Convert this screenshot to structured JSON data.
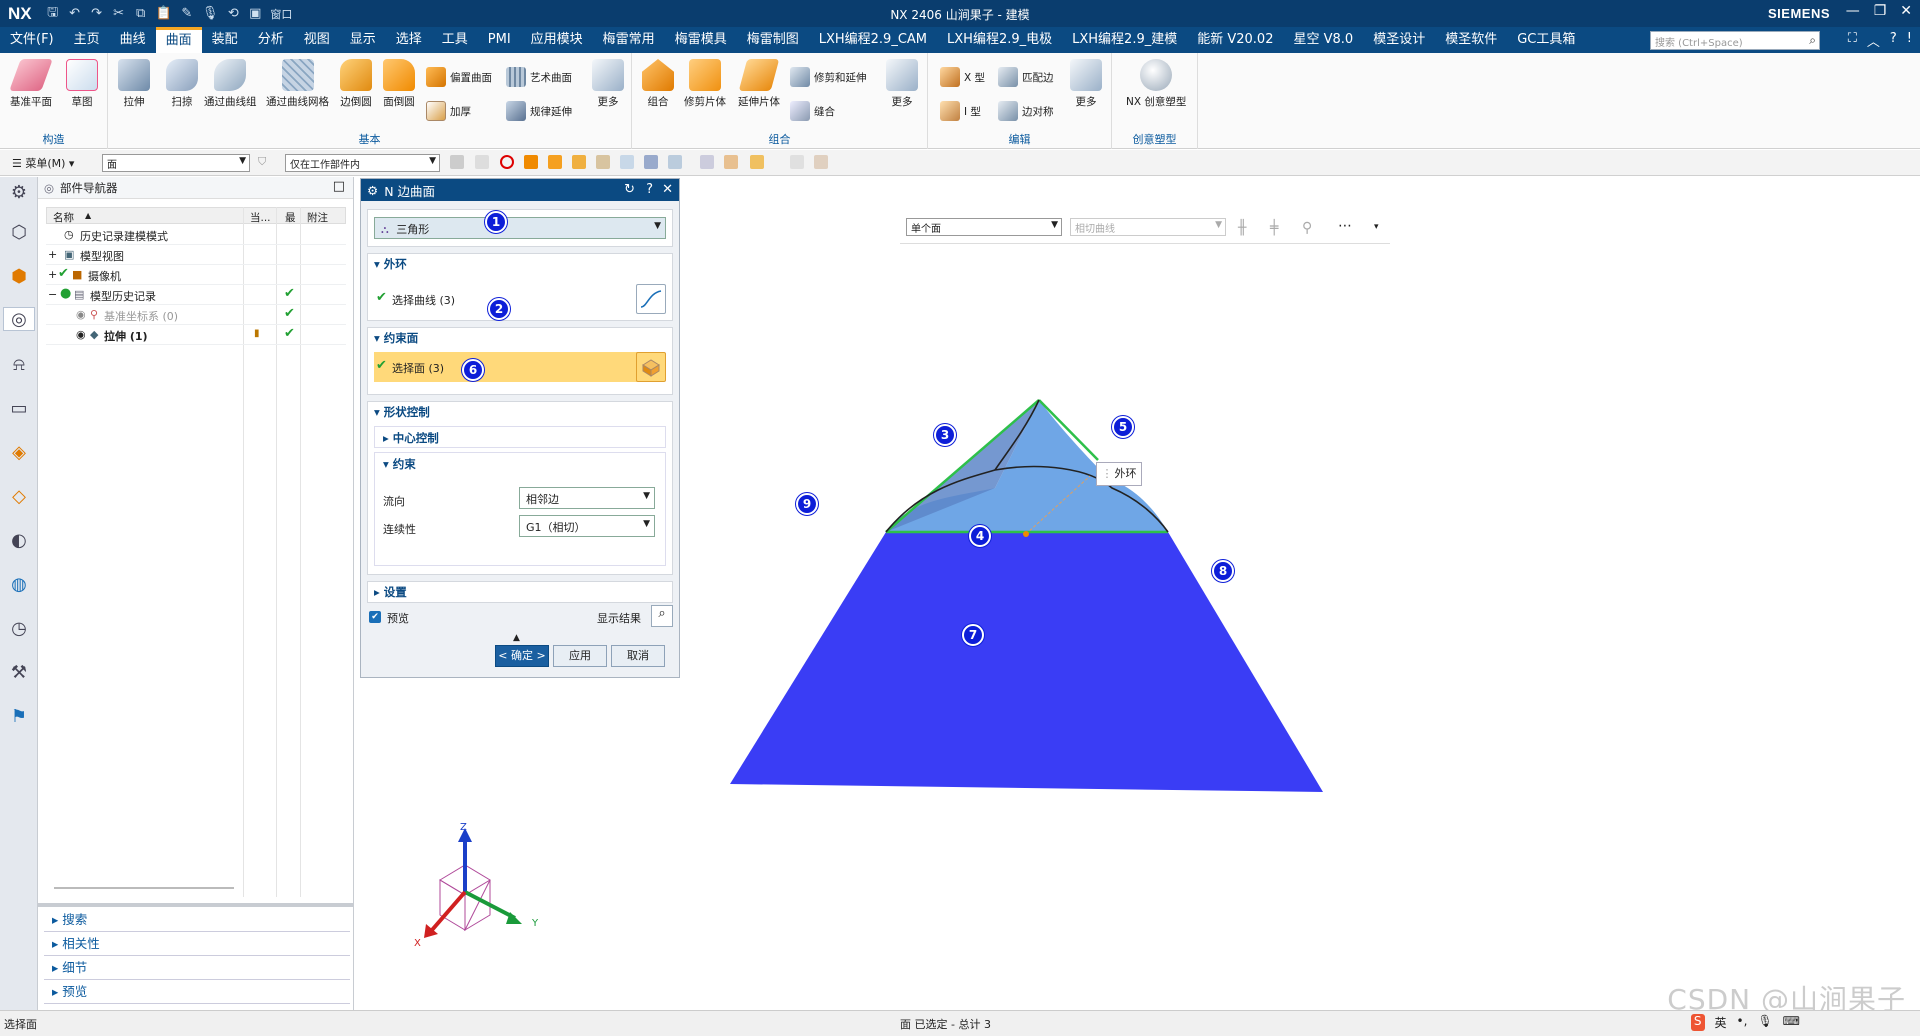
{
  "titlebar": {
    "logo": "NX",
    "title": "NX 2406 山涧果子 - 建模",
    "brand": "SIEMENS",
    "window_menu": "窗口"
  },
  "menubar": {
    "items": [
      "文件(F)",
      "主页",
      "曲线",
      "曲面",
      "装配",
      "分析",
      "视图",
      "显示",
      "选择",
      "工具",
      "PMI",
      "应用模块",
      "梅雷常用",
      "梅雷模具",
      "梅雷制图",
      "LXH编程2.9_CAM",
      "LXH编程2.9_电极",
      "LXH编程2.9_建模",
      "能新 V20.02",
      "星空 V8.0",
      "模圣设计",
      "模圣软件",
      "GC工具箱"
    ],
    "active": "曲面",
    "search_placeholder": "搜索 (Ctrl+Space)"
  },
  "ribbon": {
    "groups": {
      "construct": "构造",
      "basic": "基本",
      "combine": "组合",
      "edit": "编辑",
      "creative": "创意塑型"
    },
    "buttons": {
      "datum_plane": "基准平面",
      "sketch": "草图",
      "extrude": "拉伸",
      "sweep": "扫掠",
      "through_curves": "通过曲线组",
      "through_mesh": "通过曲线网格",
      "edge_blend": "边倒圆",
      "face_blend": "面倒圆",
      "offset_surface": "偏置曲面",
      "thicken": "加厚",
      "studio_surface": "艺术曲面",
      "law_extension": "规律延伸",
      "more1": "更多",
      "unite": "组合",
      "trim_sheet": "修剪片体",
      "extend_sheet": "延伸片体",
      "trim_extend": "修剪和延伸",
      "sew": "缝合",
      "more2": "更多",
      "x_form": "X 型",
      "i_form": "I 型",
      "match_edge": "匹配边",
      "edge_symmetry": "边对称",
      "more3": "更多",
      "nx_creative": "NX 创意塑型"
    }
  },
  "toolbar2": {
    "menu": "菜单(M)",
    "filter": "面",
    "scope": "仅在工作部件内"
  },
  "navigator": {
    "title": "部件导航器",
    "columns": [
      "名称",
      "当...",
      "最",
      "附注"
    ],
    "rows": [
      {
        "label": "历史记录建模模式",
        "current": "",
        "latest": "",
        "note": ""
      },
      {
        "label": "模型视图",
        "current": "",
        "latest": "",
        "note": ""
      },
      {
        "label": "摄像机",
        "current": "",
        "latest": "",
        "note": ""
      },
      {
        "label": "模型历史记录",
        "current": "",
        "latest": "✔",
        "note": ""
      },
      {
        "label": "基准坐标系 (0)",
        "current": "",
        "latest": "✔",
        "note": ""
      },
      {
        "label": "拉伸 (1)",
        "current": "",
        "latest": "✔",
        "note": ""
      }
    ],
    "bottom_panels": [
      "搜索",
      "相关性",
      "细节",
      "预览"
    ]
  },
  "dialog": {
    "title": "N 边曲面",
    "type_value": "三角形",
    "outer_loop": {
      "header": "外环",
      "select_label": "选择曲线 (3)"
    },
    "constraint_face": {
      "header": "约束面",
      "select_label": "选择面 (3)"
    },
    "shape_control": {
      "header": "形状控制",
      "center_control": "中心控制",
      "constraint": "约束",
      "flow_label": "流向",
      "flow_value": "相邻边",
      "continuity_label": "连续性",
      "continuity_value": "G1（相切）"
    },
    "settings": "设置",
    "preview_label": "预览",
    "show_result": "显示结果",
    "ok": "< 确定 >",
    "apply": "应用",
    "cancel": "取消"
  },
  "graphics": {
    "selection_filter": "单个面",
    "curve_rule": "相切曲线",
    "tooltip": "外环",
    "axis_labels": {
      "z": "Z",
      "y": "Y",
      "x": "X"
    },
    "badges": [
      "1",
      "2",
      "3",
      "4",
      "5",
      "6",
      "7",
      "8",
      "9"
    ],
    "colors": {
      "base_face": "#3a3df5",
      "n_side": "#6fa6e6",
      "boundary": "#2ec04a"
    }
  },
  "status": {
    "left": "选择面",
    "center": "面 已选定 - 总计 3"
  },
  "watermark": "CSDN @山涧果子"
}
